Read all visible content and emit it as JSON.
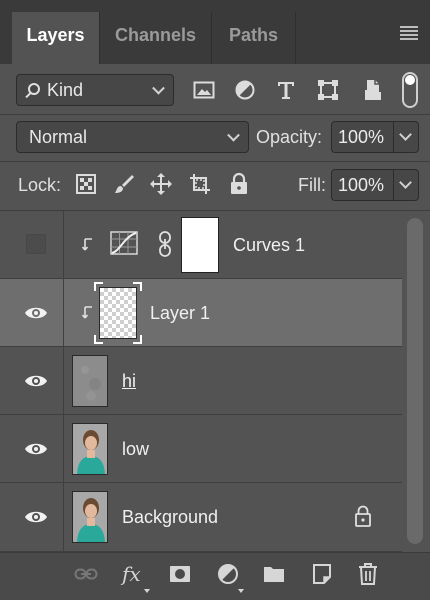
{
  "tabs": [
    {
      "label": "Layers",
      "active": true
    },
    {
      "label": "Channels",
      "active": false
    },
    {
      "label": "Paths",
      "active": false
    }
  ],
  "filter": {
    "kind_label": "Kind",
    "filter_icons": [
      "image-filter-icon",
      "adjustment-filter-icon",
      "type-filter-icon",
      "shape-filter-icon",
      "smart-object-filter-icon"
    ]
  },
  "blend": {
    "mode": "Normal",
    "opacity_label": "Opacity:",
    "opacity_value": "100%"
  },
  "lock": {
    "label": "Lock:",
    "fill_label": "Fill:",
    "fill_value": "100%"
  },
  "layers": [
    {
      "name": "Curves 1",
      "visible": false,
      "clipped": true,
      "type": "adjustment"
    },
    {
      "name": "Layer 1",
      "visible": true,
      "clipped": true,
      "type": "pixel",
      "selected": true
    },
    {
      "name": "hi",
      "visible": true,
      "clipped": false,
      "type": "pixel"
    },
    {
      "name": "low",
      "visible": true,
      "clipped": false,
      "type": "pixel"
    },
    {
      "name": "Background",
      "visible": true,
      "clipped": false,
      "type": "pixel",
      "locked": true
    }
  ],
  "bottom_icons": [
    "link-layers-icon",
    "fx-icon",
    "add-mask-icon",
    "new-adjustment-icon",
    "new-group-icon",
    "new-layer-icon",
    "delete-layer-icon"
  ],
  "colors": {
    "panel_bg": "#535353",
    "tab_bar_bg": "#3a3a3a",
    "selected_row_bg": "#6e6e6e"
  }
}
